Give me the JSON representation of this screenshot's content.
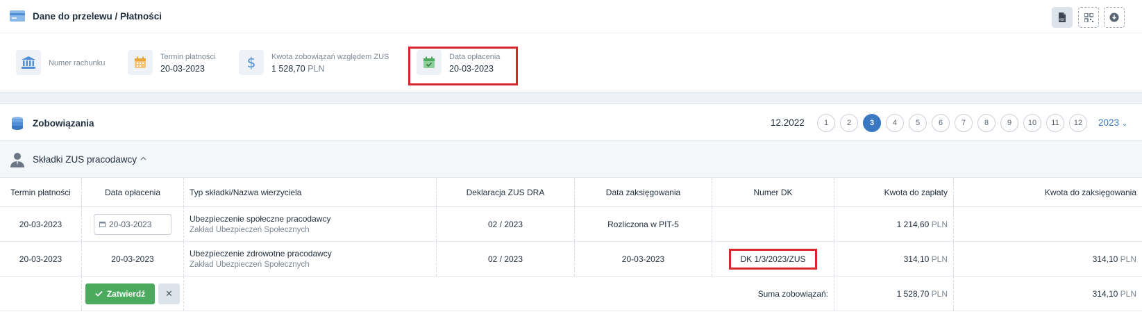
{
  "payment_card": {
    "title": "Dane do przelewu / Płatności",
    "toolbar": {
      "pdf_icon": "pdf-icon",
      "qr_icon": "qr-code-icon",
      "download_icon": "download-icon"
    },
    "account_label": "Numer rachunku",
    "due_label": "Termin płatności",
    "due_value": "20-03-2023",
    "amount_label": "Kwota zobowiązań względem ZUS",
    "amount_value": "1 528,70",
    "amount_currency": "PLN",
    "paid_label": "Data opłacenia",
    "paid_value": "20-03-2023",
    "colors": {
      "accent": "#3a78c2",
      "highlight": "#d9262e",
      "success": "#4caa5e"
    }
  },
  "obligations": {
    "title": "Zobowiązania",
    "period": "12.2022",
    "months": [
      "1",
      "2",
      "3",
      "4",
      "5",
      "6",
      "7",
      "8",
      "9",
      "10",
      "11",
      "12"
    ],
    "active_month": "3",
    "year": "2023",
    "section_title": "Składki ZUS pracodawcy",
    "columns": {
      "due": "Termin płatności",
      "paid": "Data opłacenia",
      "type": "Typ składki/Nazwa wierzyciela",
      "decl": "Deklaracja ZUS DRA",
      "booked": "Data zaksięgowania",
      "dk": "Numer DK",
      "to_pay": "Kwota do zapłaty",
      "to_book": "Kwota do zaksięgowania"
    },
    "rows": [
      {
        "due": "20-03-2023",
        "paid": "20-03-2023",
        "type": "Ubezpieczenie społeczne pracodawcy",
        "creditor": "Zakład Ubezpieczeń Społecznych",
        "decl": "02 / 2023",
        "booked": "Rozliczona w PIT-5",
        "dk": "",
        "to_pay": "1 214,60",
        "to_book": "",
        "currency": "PLN"
      },
      {
        "due": "20-03-2023",
        "paid": "20-03-2023",
        "type": "Ubezpieczenie zdrowotne pracodawcy",
        "creditor": "Zakład Ubezpieczeń Społecznych",
        "decl": "02 / 2023",
        "booked": "20-03-2023",
        "dk": "DK 1/3/2023/ZUS",
        "to_pay": "314,10",
        "to_book": "314,10",
        "currency": "PLN"
      }
    ],
    "footer": {
      "confirm_label": "Zatwierdź",
      "cancel_label": "✕",
      "sum_label": "Suma zobowiązań:",
      "sum_to_pay": "1 528,70",
      "sum_to_book": "314,10",
      "currency": "PLN"
    }
  }
}
